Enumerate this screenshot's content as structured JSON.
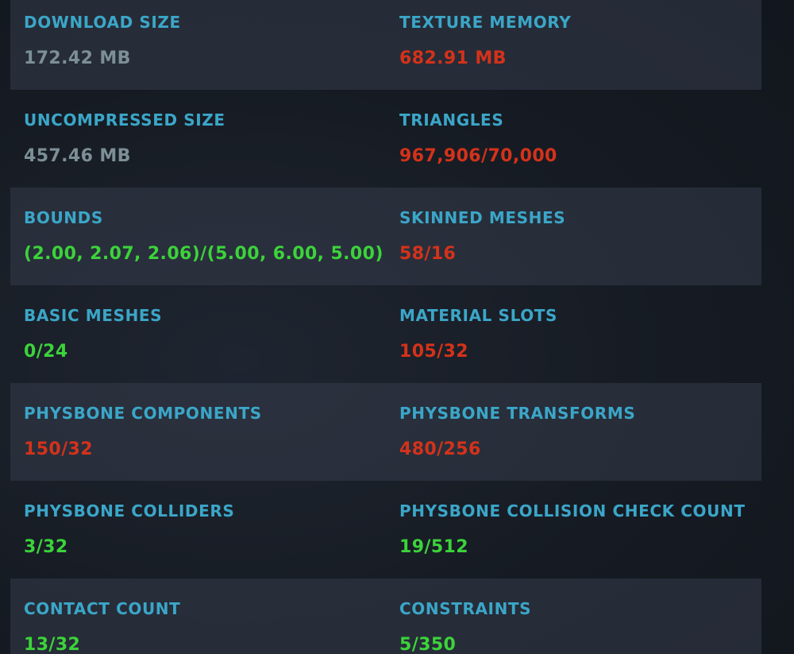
{
  "colors": {
    "label": "#3ba6c8",
    "neutral": "#7c8f96",
    "bad": "#d4321a",
    "good": "#3cd33a"
  },
  "rows": [
    {
      "left": {
        "label": "DOWNLOAD SIZE",
        "value": "172.42 MB",
        "status": "neutral"
      },
      "right": {
        "label": "TEXTURE MEMORY",
        "value": "682.91 MB",
        "status": "bad"
      }
    },
    {
      "left": {
        "label": "UNCOMPRESSED SIZE",
        "value": "457.46 MB",
        "status": "neutral"
      },
      "right": {
        "label": "TRIANGLES",
        "value": "967,906/70,000",
        "status": "bad"
      }
    },
    {
      "left": {
        "label": "BOUNDS",
        "value": "(2.00, 2.07, 2.06)/(5.00, 6.00, 5.00)",
        "status": "good"
      },
      "right": {
        "label": "SKINNED MESHES",
        "value": "58/16",
        "status": "bad"
      }
    },
    {
      "left": {
        "label": "BASIC MESHES",
        "value": "0/24",
        "status": "good"
      },
      "right": {
        "label": "MATERIAL SLOTS",
        "value": "105/32",
        "status": "bad"
      }
    },
    {
      "left": {
        "label": "PHYSBONE COMPONENTS",
        "value": "150/32",
        "status": "bad"
      },
      "right": {
        "label": "PHYSBONE TRANSFORMS",
        "value": "480/256",
        "status": "bad"
      }
    },
    {
      "left": {
        "label": "PHYSBONE COLLIDERS",
        "value": "3/32",
        "status": "good"
      },
      "right": {
        "label": "PHYSBONE COLLISION CHECK COUNT",
        "value": "19/512",
        "status": "good"
      }
    },
    {
      "left": {
        "label": "CONTACT COUNT",
        "value": "13/32",
        "status": "good"
      },
      "right": {
        "label": "CONSTRAINTS",
        "value": "5/350",
        "status": "good"
      }
    }
  ]
}
